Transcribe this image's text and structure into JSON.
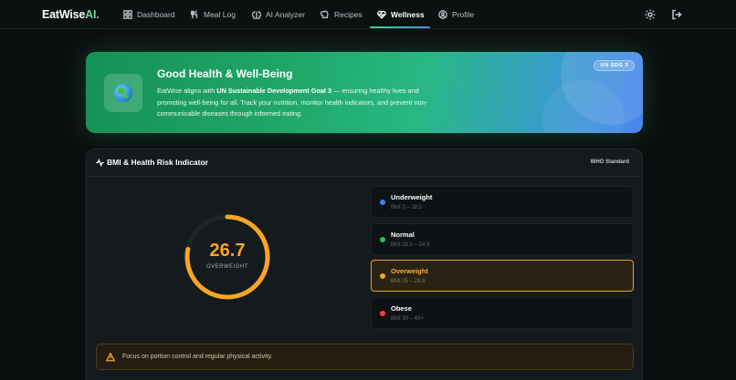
{
  "nav": {
    "brand": "EatWise",
    "brand_suffix": "AI.",
    "items": [
      {
        "label": "Dashboard",
        "icon": "grid-icon"
      },
      {
        "label": "Meal Log",
        "icon": "utensils-icon"
      },
      {
        "label": "AI Analyzer",
        "icon": "brain-icon"
      },
      {
        "label": "Recipes",
        "icon": "chef-hat-icon"
      },
      {
        "label": "Wellness",
        "icon": "heart-pulse-icon",
        "active": true
      },
      {
        "label": "Profile",
        "icon": "user-circle-icon"
      }
    ],
    "actions": [
      "sun-icon",
      "logout-icon"
    ]
  },
  "sdg": {
    "title": "Good Health & Well-Being",
    "desc_pre": "EatWise aligns with ",
    "desc_bold": "UN Sustainable Development Goal 3",
    "desc_post": " — ensuring healthy lives and promoting well-being for all. Track your nutrition, monitor health indicators, and prevent non-communicable diseases through informed eating.",
    "badge": "UN SDG 3",
    "icon": "globe-icon"
  },
  "bmi": {
    "title": "BMI & Health Risk Indicator",
    "standard": "WHO Standard",
    "value": "26.7",
    "status": "OVERWEIGHT",
    "gauge_fraction": 0.78,
    "accent": "#f5a623",
    "categories": [
      {
        "name": "Underweight",
        "range": "BMI 0 – 18.5",
        "color": "#3b82f6"
      },
      {
        "name": "Normal",
        "range": "BMI 18.5 – 24.9",
        "color": "#22c55e"
      },
      {
        "name": "Overweight",
        "range": "BMI 25 – 29.9",
        "color": "#f5a623",
        "active": true
      },
      {
        "name": "Obese",
        "range": "BMI 30 – 40+",
        "color": "#ef4444"
      }
    ],
    "tip": "Focus on portion control and regular physical activity."
  }
}
